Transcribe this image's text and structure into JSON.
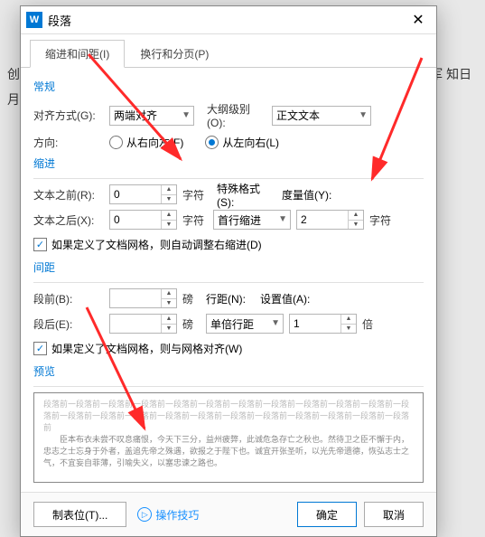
{
  "bg_text": "创业 ，思 ，惊 帝 府问 踣 ，作 中 之事 向发 之彰 论此 下郭 布衣 臣于 ，受 军 知日 月渡 ，兴 称， 懈 宽 为 为 ，侍 每 矣 三 。",
  "titlebar": {
    "title": "段落"
  },
  "tabs": {
    "indent": "缩进和间距(I)",
    "flow": "换行和分页(P)"
  },
  "sections": {
    "general": "常规",
    "indent": "缩进",
    "spacing": "间距",
    "preview": "预览"
  },
  "labels": {
    "alignment": "对齐方式(G):",
    "outline": "大纲级别(O):",
    "direction": "方向:",
    "rtl": "从右向左(F)",
    "ltr": "从左向右(L)",
    "before_text": "文本之前(R):",
    "after_text": "文本之后(X):",
    "special": "特殊格式(S):",
    "metric": "度量值(Y):",
    "char_unit": "字符",
    "grid_indent": "如果定义了文档网格，则自动调整右缩进(D)",
    "space_before": "段前(B):",
    "space_after": "段后(E):",
    "line_spacing": "行距(N):",
    "set_value": "设置值(A):",
    "pt": "磅",
    "times": "倍",
    "grid_align": "如果定义了文档网格，则与网格对齐(W)"
  },
  "values": {
    "alignment": "两端对齐",
    "outline": "正文文本",
    "before_text": "0",
    "after_text": "0",
    "special": "首行缩进",
    "metric": "2",
    "space_before": "",
    "space_after": "",
    "line_spacing": "单倍行距",
    "set_value": "1"
  },
  "preview": {
    "ghost": "段落前一段落前一段落前一段落前一段落前一段落前一段落前一段落前一段落前一段落前一段落前一段落前一段落前一段落前一段落前一段落前一段落前一段落前一段落前一段落前一段落前一段落前一段落前",
    "sample": "臣本布衣未尝不叹息痛恨，今天下三分，益州疲弊，此诚危急存亡之秋也。然待卫之臣不懈于内，忠志之士忘身于外者，盖追先帝之殊遇，欲报之于陛下也。诚宜开张圣听，以光先帝遗德，恢弘志士之气，不宜妄自菲薄，引喻失义，以塞忠谏之路也。"
  },
  "footer": {
    "tabstops": "制表位(T)...",
    "tips": "操作技巧",
    "ok": "确定",
    "cancel": "取消"
  }
}
